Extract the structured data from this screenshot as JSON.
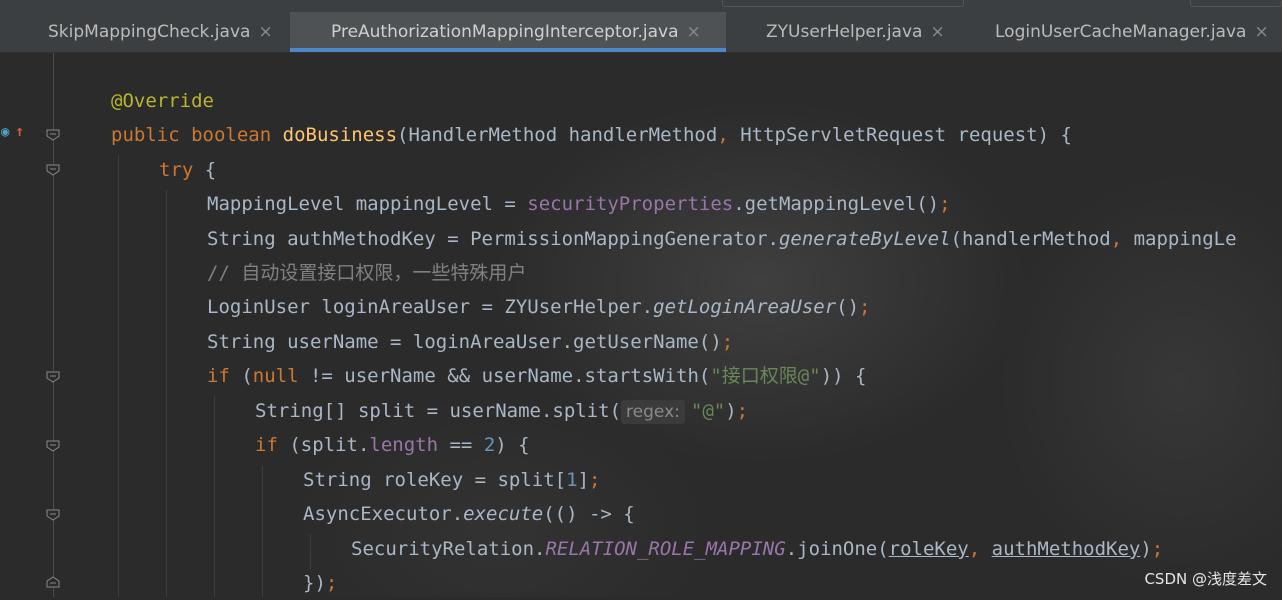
{
  "tabs": [
    {
      "label": "SkipMappingCheck.java",
      "close": "×",
      "active": false
    },
    {
      "label": "PreAuthorizationMappingInterceptor.java",
      "close": "×",
      "active": true
    },
    {
      "label": "ZYUserHelper.java",
      "close": "×",
      "active": false
    },
    {
      "label": "LoginUserCacheManager.java",
      "close": "×",
      "active": false
    }
  ],
  "code": {
    "l1": {
      "ann": "@Override"
    },
    "l2": {
      "public": "public",
      "boolean": "boolean",
      "method": "doBusiness",
      "sig": "(HandlerMethod handlerMethod",
      "comma": ",",
      "sig2": " HttpServletRequest request) {"
    },
    "l3": {
      "try": "try",
      "rest": " {"
    },
    "l4": {
      "a": "MappingLevel mappingLevel = ",
      "field": "securityProperties",
      "b": ".getMappingLevel()",
      "semi": ";"
    },
    "l5": {
      "a": "String authMethodKey = PermissionMappingGenerator.",
      "ital": "generateByLevel",
      "b": "(handlerMethod",
      "comma": ",",
      "c": " mappingLe"
    },
    "l6": {
      "comment": "// 自动设置接口权限，一些特殊用户"
    },
    "l7": {
      "a": "LoginUser loginAreaUser = ZYUserHelper.",
      "ital": "getLoginAreaUser",
      "b": "()",
      "semi": ";"
    },
    "l8": {
      "a": "String userName = loginAreaUser.getUserName()",
      "semi": ";"
    },
    "l9": {
      "if": "if",
      "a": " (",
      "null": "null",
      "b": " != userName && userName.startsWith(",
      "str": "\"接口权限@\"",
      "c": ")) {"
    },
    "l10": {
      "a": "String[] split = userName.split(",
      "hint": "regex:",
      "str": "\"@\"",
      "b": ")",
      "semi": ";"
    },
    "l11": {
      "if": "if",
      "a": " (split.",
      "field": "length",
      "b": " == ",
      "num": "2",
      "c": ") {"
    },
    "l12": {
      "a": "String roleKey = split[",
      "num": "1",
      "b": "]",
      "semi": ";"
    },
    "l13": {
      "a": "AsyncExecutor.",
      "ital": "execute",
      "b": "(() -> {"
    },
    "l14": {
      "a": "SecurityRelation.",
      "static": "RELATION_ROLE_MAPPING",
      "b": ".joinOne(",
      "u1": "roleKey",
      "comma": ",",
      "sp": " ",
      "u2": "authMethodKey",
      "c": ")",
      "semi": ";"
    },
    "l15": {
      "a": "})",
      "semi": ";"
    }
  },
  "watermark": "CSDN @浅度差文"
}
